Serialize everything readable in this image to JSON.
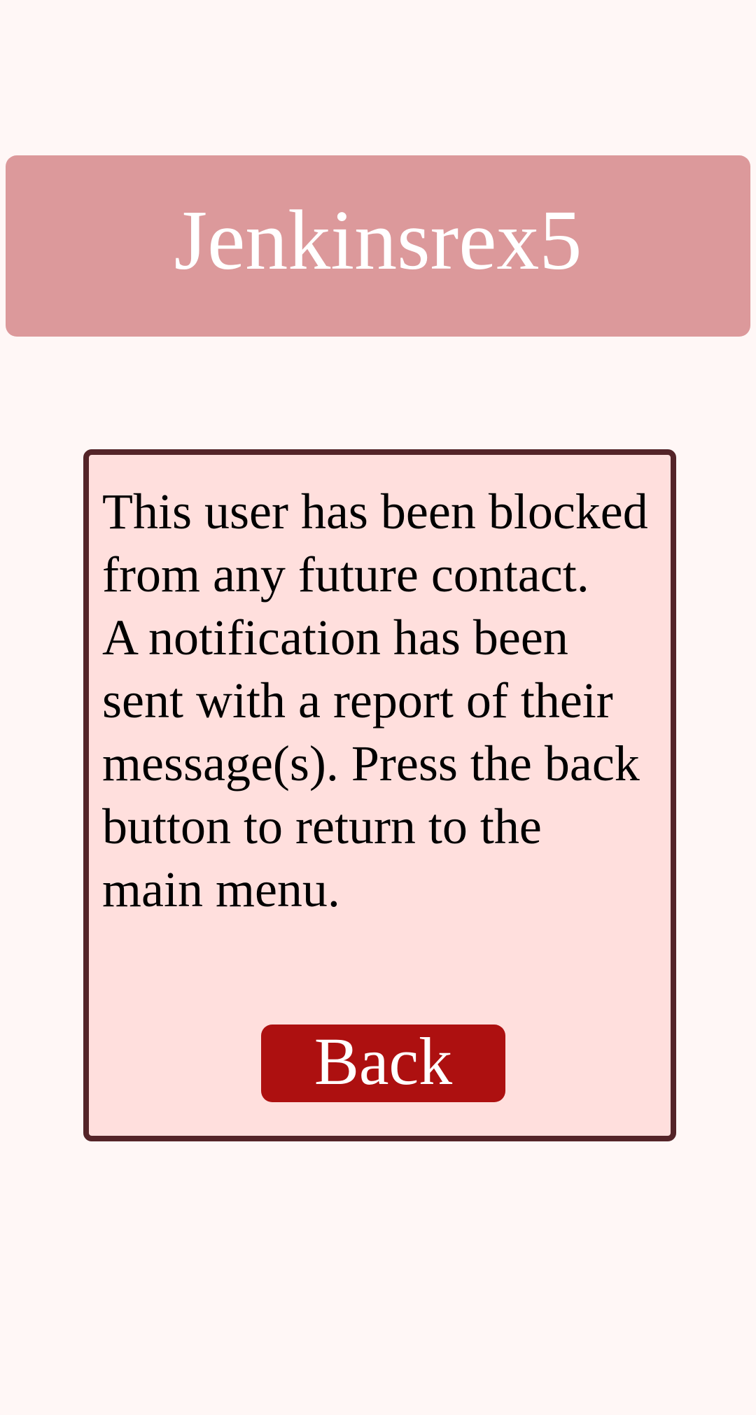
{
  "header": {
    "title": "Jenkinsrex5"
  },
  "panel": {
    "message_lines": [
      "This user has been blocked",
      "from any future contact.",
      "A notification has been",
      "sent with a report of their",
      "message(s). Press the back",
      "button to return to the",
      "main menu."
    ],
    "back_label": "Back"
  },
  "colors": {
    "background": "#fff7f6",
    "header_bg": "#dc999b",
    "panel_bg": "#ffdfdd",
    "panel_border": "#542428",
    "button_bg": "#ad1010",
    "text_light": "#ffffff",
    "text_dark": "#000000"
  }
}
